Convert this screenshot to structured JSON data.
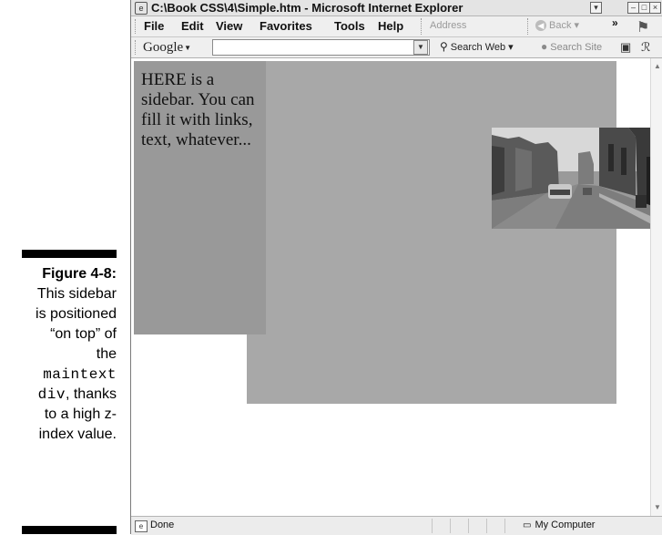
{
  "caption": {
    "figure": "Figure 4-8:",
    "line1": "This sidebar",
    "line2": "is positioned",
    "line3": "“on top” of",
    "line4": "the",
    "code1": "maintext",
    "code2": "div",
    "line5_tail": ", thanks",
    "line6": "to a high z-",
    "line7": "index value."
  },
  "window": {
    "title": "C:\\Book CSS\\4\\Simple.htm - Microsoft Internet Explorer",
    "menu": [
      {
        "label": "File"
      },
      {
        "label": "Edit"
      },
      {
        "label": "View"
      },
      {
        "label": "Favorites"
      },
      {
        "label": "Tools"
      },
      {
        "label": "Help"
      }
    ],
    "address_label": "Address",
    "back_label": "Back",
    "more_chevron": "»"
  },
  "google_toolbar": {
    "brand": "Google",
    "search_value": "",
    "search_web_label": "Search Web",
    "search_site_label": "Search Site"
  },
  "page": {
    "sidebar_text": "HERE is a sidebar. You can fill it with links, text, whatever..."
  },
  "status": {
    "text": "Done",
    "zone": "My Computer"
  },
  "colors": {
    "maintext_bg": "#a8a8a8",
    "sidebar_bg": "#999999"
  }
}
